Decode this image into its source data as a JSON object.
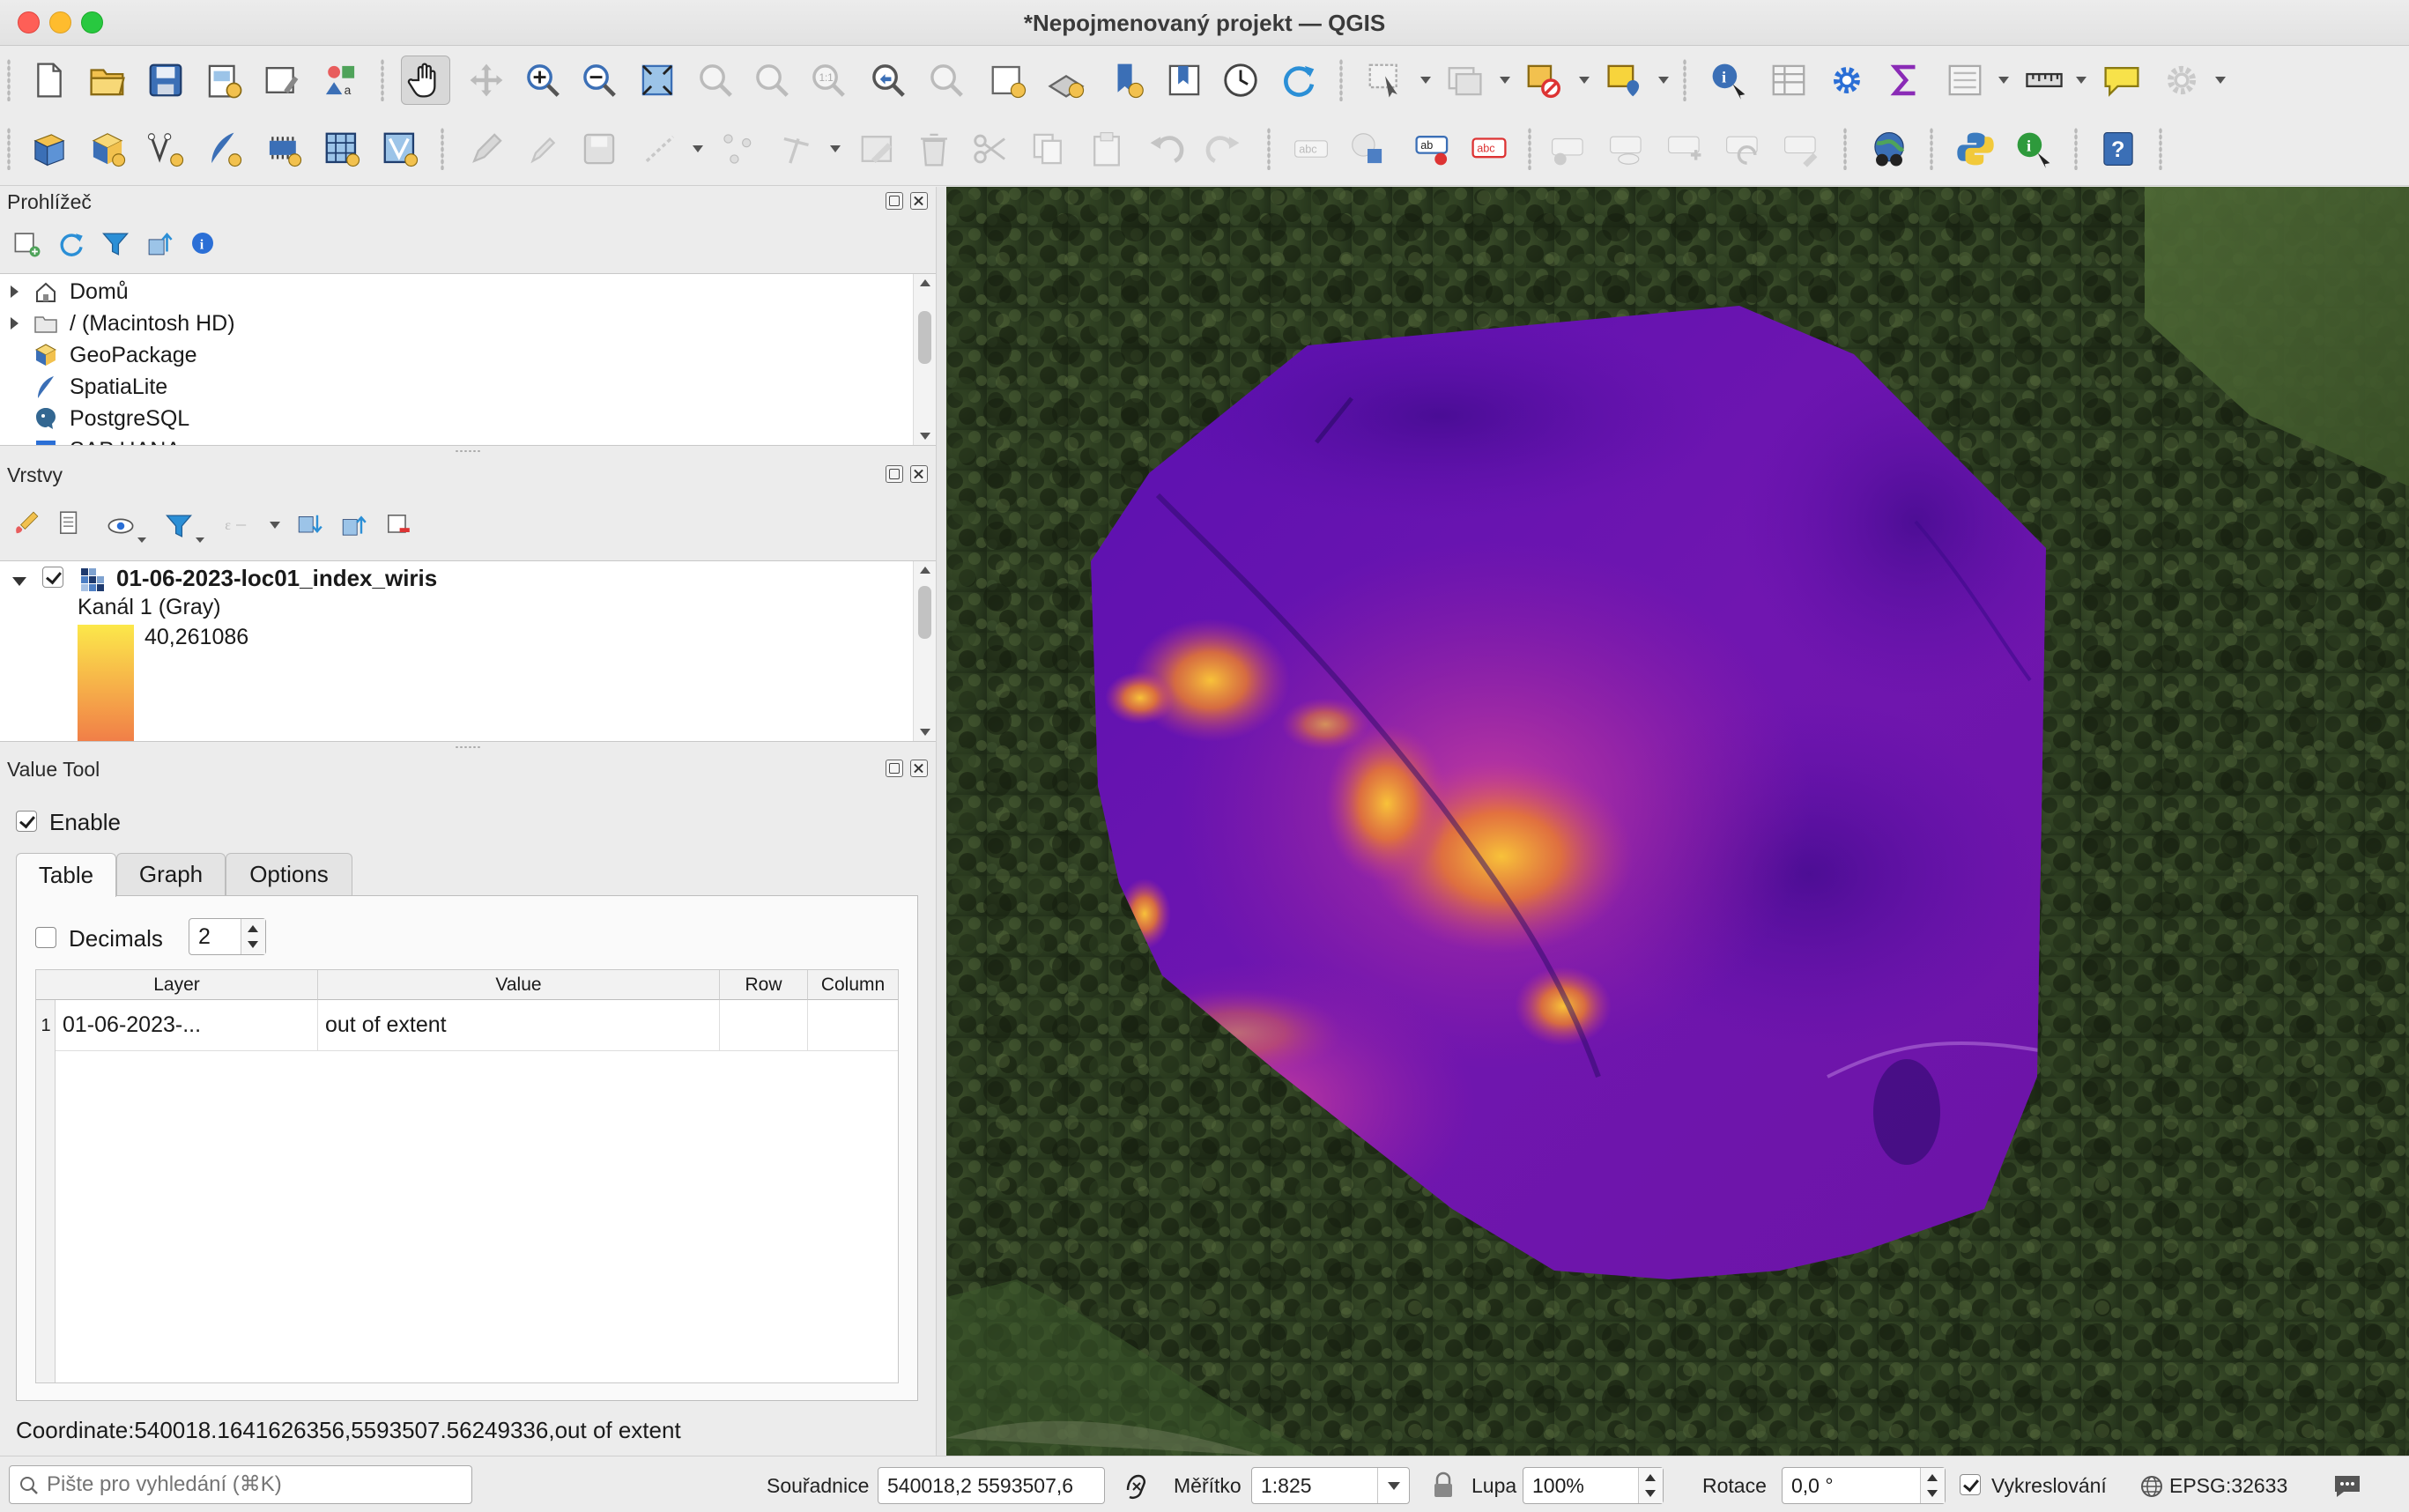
{
  "window": {
    "title": "*Nepojmenovaný projekt — QGIS"
  },
  "browser_panel": {
    "title": "Prohlížeč",
    "items": [
      {
        "label": "Domů",
        "icon": "home-icon",
        "expandable": true
      },
      {
        "label": "/ (Macintosh HD)",
        "icon": "folder-icon",
        "expandable": true
      },
      {
        "label": "GeoPackage",
        "icon": "geopackage-icon",
        "expandable": false
      },
      {
        "label": "SpatiaLite",
        "icon": "spatialite-icon",
        "expandable": false
      },
      {
        "label": "PostgreSQL",
        "icon": "postgresql-icon",
        "expandable": false
      },
      {
        "label": "SAP HANA",
        "icon": "sap-hana-icon",
        "expandable": false
      }
    ]
  },
  "layers_panel": {
    "title": "Vrstvy",
    "layer": {
      "name": "01-06-2023-loc01_index_wiris",
      "visible": true,
      "band": "Kanál 1 (Gray)",
      "legend_value": "40,261086",
      "ramp_top": "#fce84a",
      "ramp_bottom": "#f07848"
    }
  },
  "value_tool": {
    "title": "Value Tool",
    "enable_label": "Enable",
    "enabled": true,
    "tabs": [
      "Table",
      "Graph",
      "Options"
    ],
    "active_tab": "Table",
    "decimals_label": "Decimals",
    "decimals_checked": false,
    "decimals_value": "2",
    "columns": [
      "Layer",
      "Value",
      "Row",
      "Column"
    ],
    "rows": [
      {
        "index": "1",
        "layer": "01-06-2023-...",
        "value": "out of extent",
        "row": "",
        "column": ""
      }
    ],
    "coordinate_text": "Coordinate:540018.1641626356,5593507.56249336,out of extent"
  },
  "statusbar": {
    "search_placeholder": "Pište pro vyhledání (⌘K)",
    "coord_label": "Souřadnice",
    "coord_value": "540018,2  5593507,6",
    "scale_label": "Měřítko",
    "scale_value": "1:825",
    "magnifier_label": "Lupa",
    "magnifier_value": "100%",
    "rotation_label": "Rotace",
    "rotation_value": "0,0 °",
    "render_label": "Vykreslování",
    "render_checked": true,
    "crs_label": "EPSG:32633"
  },
  "colors": {
    "accent": "#1f6fd1",
    "raster_low": "#5a0fa8",
    "raster_high": "#f8c23a"
  }
}
